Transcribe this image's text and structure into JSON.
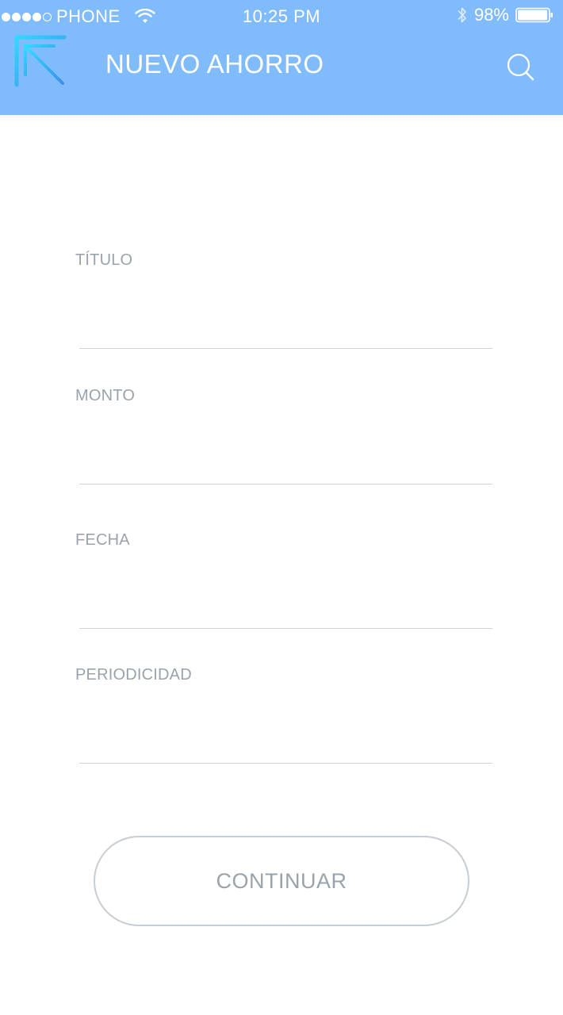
{
  "status_bar": {
    "carrier": "PHONE",
    "time": "10:25 PM",
    "battery_percent": "98%",
    "battery_level": 0.98
  },
  "nav": {
    "title": "NUEVO AHORRO",
    "back_icon": "arrow-up-left-icon",
    "search_icon": "search-icon"
  },
  "form": {
    "fields": [
      {
        "label": "TÍTULO",
        "value": ""
      },
      {
        "label": "MONTO",
        "value": ""
      },
      {
        "label": "FECHA",
        "value": ""
      },
      {
        "label": "PERIODICIDAD",
        "value": ""
      }
    ],
    "submit_label": "CONTINUAR"
  },
  "colors": {
    "header_bg": "#80bbfc",
    "back_icon_gradient_start": "#33d8ff",
    "back_icon_gradient_end": "#3a8fe8",
    "label": "#9aa3ab",
    "divider": "#cfd4d9",
    "button_border": "#c7cdd3"
  }
}
